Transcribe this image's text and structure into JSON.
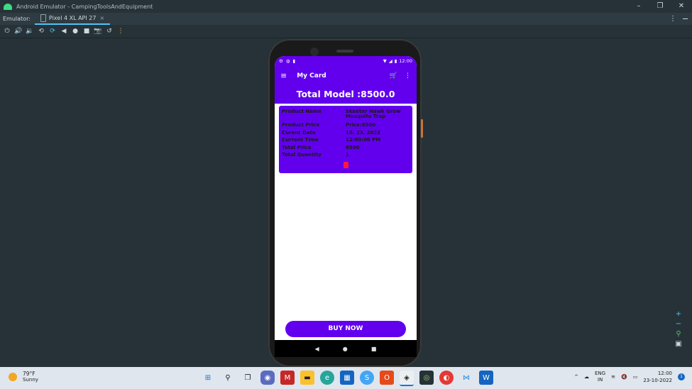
{
  "window": {
    "title": "Android Emulator - CampingToolsAndEquipment"
  },
  "tabbar": {
    "label": "Emulator:",
    "tab_name": "Pixel 4 XL API 27"
  },
  "status": {
    "time": "12:00"
  },
  "app": {
    "title": "My Card",
    "total_label": "Total Model :8500.0",
    "buy_label": "BUY NOW"
  },
  "card": {
    "rows": [
      {
        "key": "Product Name",
        "value": "Skeeter Hawk Grow Mosquito Trap"
      },
      {
        "key": "Product Price",
        "value": "Price:8500"
      },
      {
        "key": "Curent Date",
        "value": "10. 23. 2022"
      },
      {
        "key": "Current Time",
        "value": "12:00:06 PM"
      },
      {
        "key": "Total Price",
        "value": "8500"
      },
      {
        "key": "Total Quantity",
        "value": "1"
      }
    ]
  },
  "taskbar": {
    "temp": "79°F",
    "weather": "Sunny",
    "lang_top": "ENG",
    "lang_bottom": "IN",
    "time": "12:00",
    "date": "23-10-2022",
    "notif_count": "1"
  },
  "colors": {
    "primary": "#6200ee",
    "delete": "#ff1744"
  }
}
